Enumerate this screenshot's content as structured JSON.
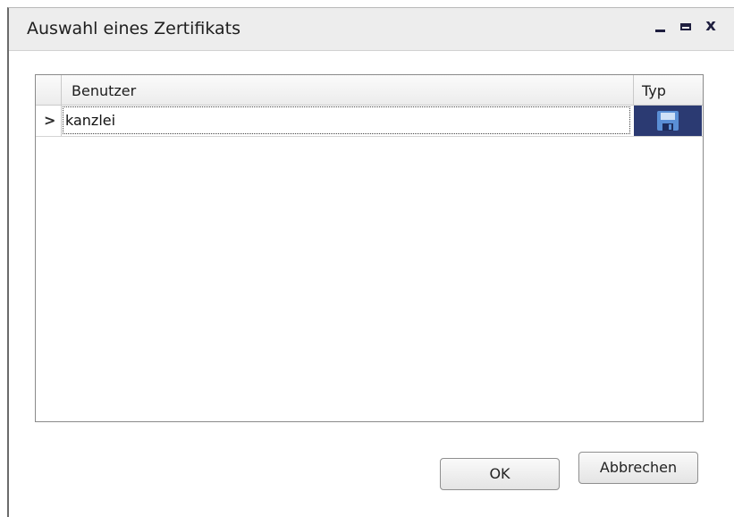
{
  "window": {
    "title": "Auswahl eines Zertifikats",
    "controls": {
      "minimize": "-",
      "maximize": "□",
      "close": "x"
    }
  },
  "grid": {
    "columns": [
      "Benutzer",
      "Typ"
    ],
    "rows": [
      {
        "indicator": ">",
        "benutzer": "kanzlei",
        "typ_icon": "floppy-disk-icon",
        "selected": true
      }
    ]
  },
  "buttons": {
    "ok": "OK",
    "cancel": "Abbrechen"
  },
  "colors": {
    "titlebar": "#ededed",
    "selection": "#2b3a72",
    "icon": "#5a8fd6"
  }
}
